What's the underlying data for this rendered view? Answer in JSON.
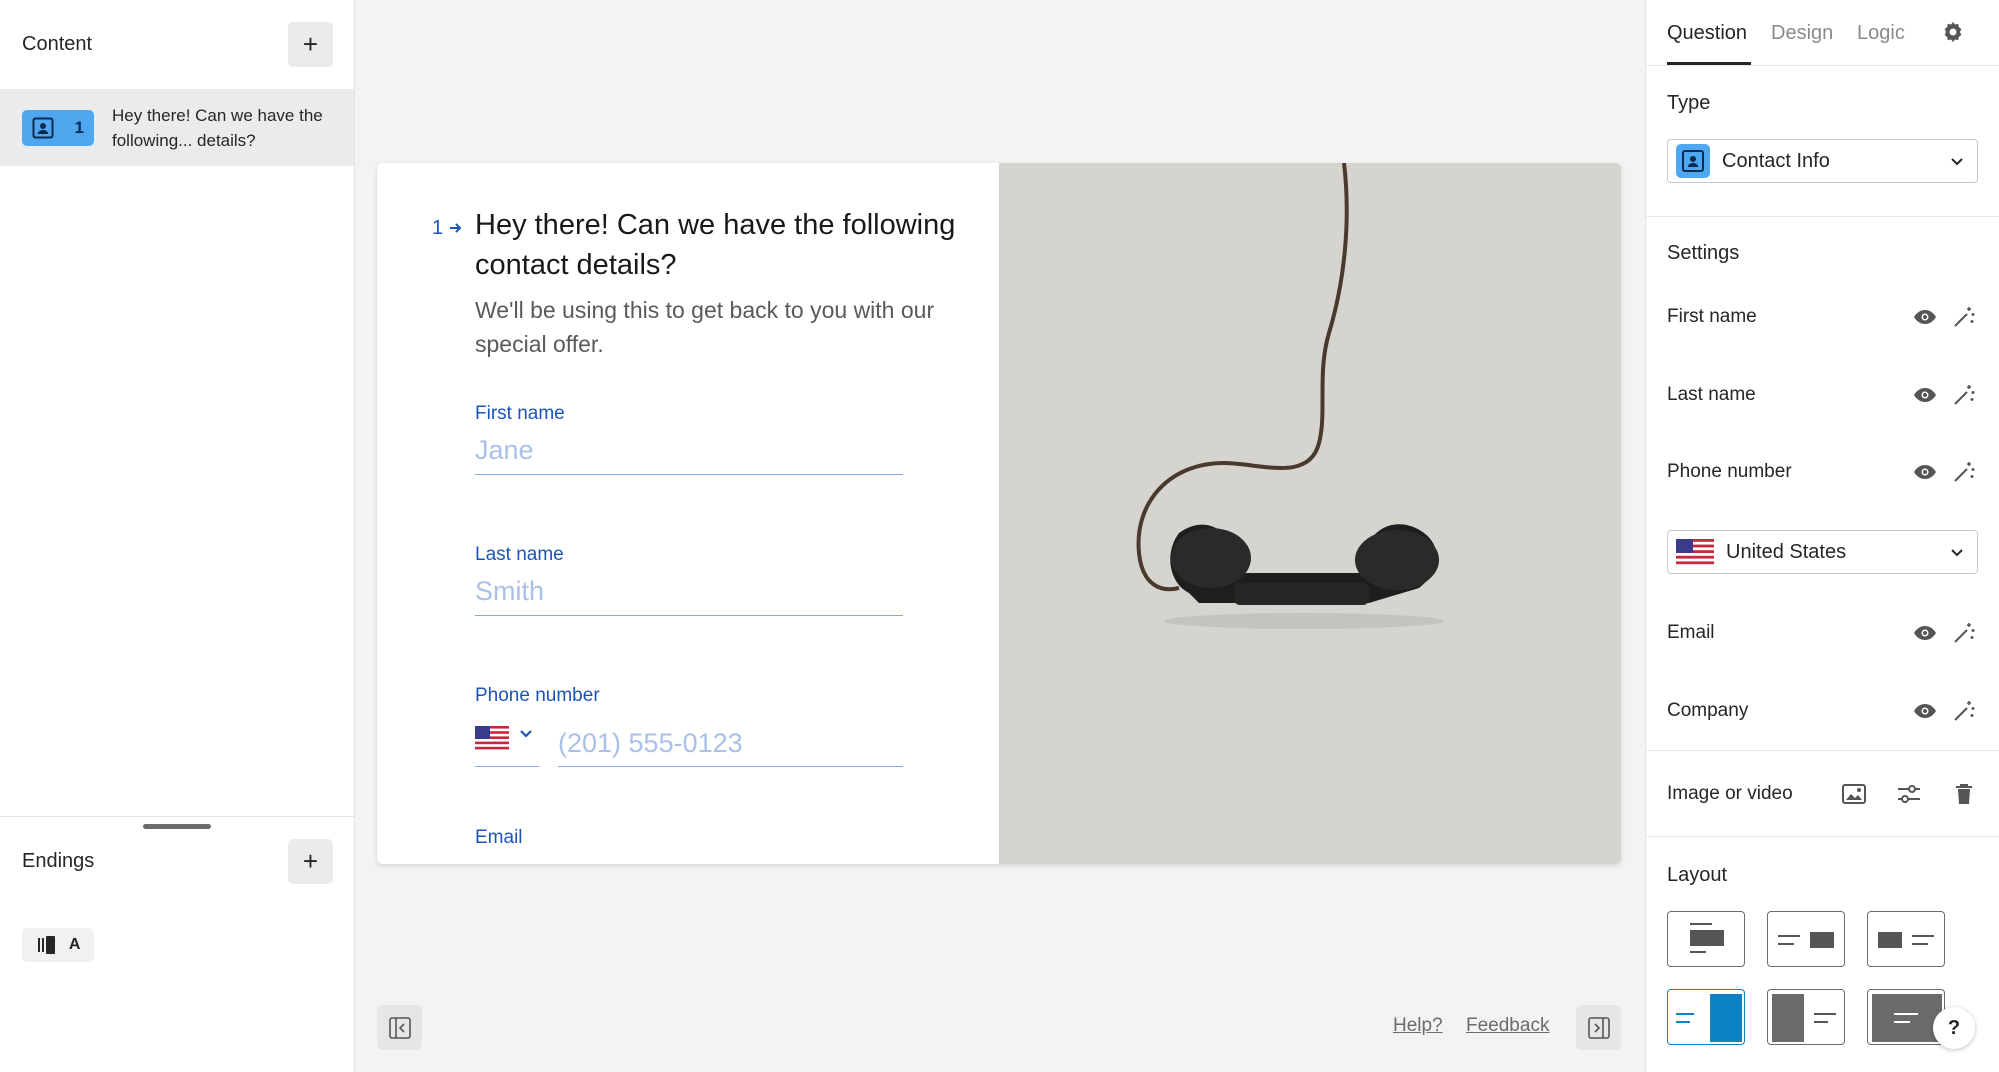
{
  "left_panel": {
    "content_title": "Content",
    "add_label": "+",
    "item": {
      "number": "1",
      "text": "Hey there! Can we have the following... details?"
    },
    "endings_title": "Endings",
    "ending_badge_letter": "A"
  },
  "form": {
    "question_number": "1",
    "title": "Hey there! Can we have the following contact details?",
    "description": "We'll be using this to get back to you with our special offer.",
    "fields": {
      "first_name_label": "First name",
      "first_name_placeholder": "Jane",
      "last_name_label": "Last name",
      "last_name_placeholder": "Smith",
      "phone_label": "Phone number",
      "phone_placeholder": "(201) 555-0123",
      "email_label": "Email"
    }
  },
  "footer": {
    "help": "Help?",
    "feedback": "Feedback"
  },
  "right_panel": {
    "tabs": [
      "Question",
      "Design",
      "Logic"
    ],
    "type_title": "Type",
    "type_value": "Contact Info",
    "settings_title": "Settings",
    "settings": [
      "First name",
      "Last name",
      "Phone number",
      "Email",
      "Company"
    ],
    "country": "United States",
    "image_title": "Image or video",
    "layout_title": "Layout",
    "help_button": "?"
  },
  "colors": {
    "accent_blue": "#1c55b8",
    "badge_blue": "#4fa7f0",
    "layout_active": "#0d82c4",
    "image_bg": "#d6d4cf"
  },
  "icons": [
    "plus-icon",
    "contact-card-icon",
    "arrow-right-icon",
    "flag-us-icon",
    "chevron-down-icon",
    "eye-icon",
    "magic-wand-icon",
    "image-icon",
    "sliders-icon",
    "trash-icon",
    "gear-icon",
    "collapse-left-icon",
    "collapse-right-icon"
  ]
}
